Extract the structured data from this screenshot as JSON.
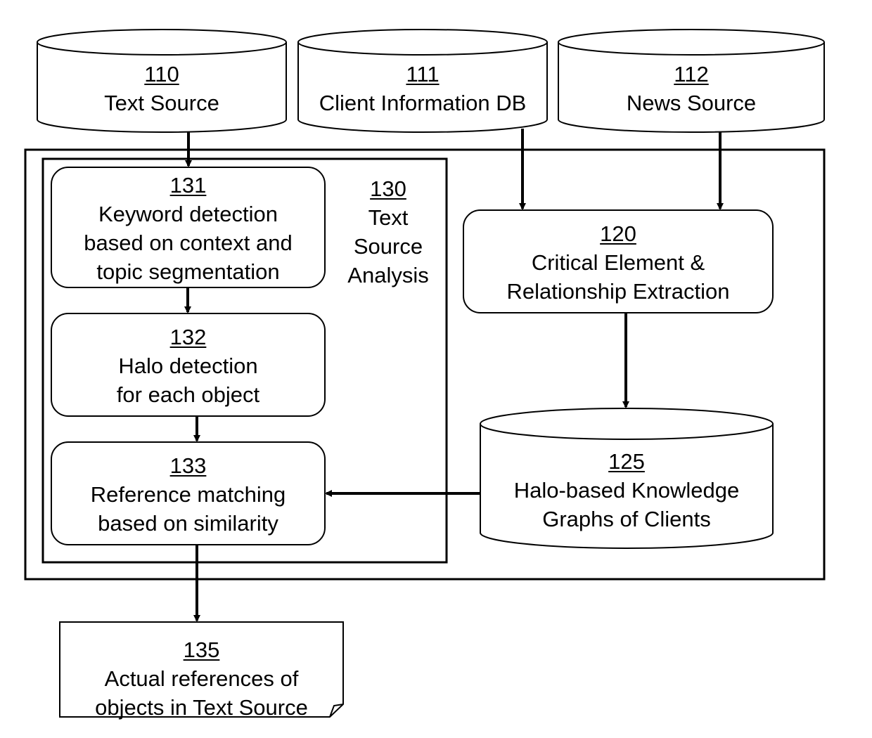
{
  "diagram": {
    "nodes": {
      "n110": {
        "number": "110",
        "lines": [
          "Text Source"
        ],
        "shape": "database"
      },
      "n111": {
        "number": "111",
        "lines": [
          "Client Information DB"
        ],
        "shape": "database"
      },
      "n112": {
        "number": "112",
        "lines": [
          "News Source"
        ],
        "shape": "database"
      },
      "n130": {
        "number": "130",
        "lines": [
          "Text",
          "Source",
          "Analysis"
        ],
        "shape": "group"
      },
      "n131": {
        "number": "131",
        "lines": [
          "Keyword detection",
          "based on context and",
          "topic segmentation"
        ],
        "shape": "process"
      },
      "n132": {
        "number": "132",
        "lines": [
          "Halo detection",
          "for each object"
        ],
        "shape": "process"
      },
      "n133": {
        "number": "133",
        "lines": [
          "Reference matching",
          "based on similarity"
        ],
        "shape": "process"
      },
      "n120": {
        "number": "120",
        "lines": [
          "Critical Element &",
          "Relationship Extraction"
        ],
        "shape": "process"
      },
      "n125": {
        "number": "125",
        "lines": [
          "Halo-based Knowledge",
          "Graphs of Clients"
        ],
        "shape": "database"
      },
      "n135": {
        "number": "135",
        "lines": [
          "Actual references of",
          "objects in Text Source"
        ],
        "shape": "document"
      }
    },
    "edges": [
      {
        "from": "110",
        "to": "131"
      },
      {
        "from": "111",
        "to": "120"
      },
      {
        "from": "112",
        "to": "120"
      },
      {
        "from": "131",
        "to": "132"
      },
      {
        "from": "132",
        "to": "133"
      },
      {
        "from": "120",
        "to": "125"
      },
      {
        "from": "125",
        "to": "133"
      },
      {
        "from": "133",
        "to": "135"
      }
    ]
  }
}
